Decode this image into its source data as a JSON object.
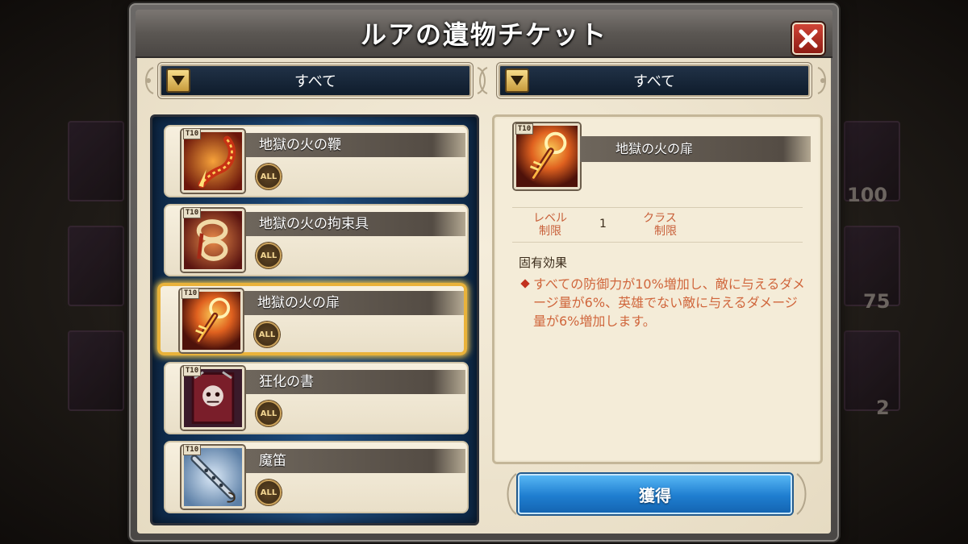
{
  "title": "ルアの遺物チケット",
  "filters": {
    "left_label": "すべて",
    "right_label": "すべて"
  },
  "background": {
    "numbers": [
      "100",
      "75",
      "2"
    ]
  },
  "items": [
    {
      "name": "地獄の火の鞭",
      "tier": "T10",
      "class_badge": "ALL",
      "icon": "flame-whip-icon"
    },
    {
      "name": "地獄の火の拘束具",
      "tier": "T10",
      "class_badge": "ALL",
      "icon": "flame-restraint-icon"
    },
    {
      "name": "地獄の火の扉",
      "tier": "T10",
      "class_badge": "ALL",
      "icon": "flame-key-icon",
      "selected": true
    },
    {
      "name": "狂化の書",
      "tier": "T10",
      "class_badge": "ALL",
      "icon": "berserk-book-icon"
    },
    {
      "name": "魔笛",
      "tier": "T10",
      "class_badge": "ALL",
      "icon": "magic-flute-icon"
    }
  ],
  "detail": {
    "name": "地獄の火の扉",
    "tier": "T10",
    "level_label_1": "レベル",
    "level_label_2": "制限",
    "level_value": "1",
    "class_label_1": "クラス",
    "class_label_2": "制限",
    "effect_title": "固有効果",
    "effect_text": "すべての防御力が10%増加し、敵に与えるダメージ量が6%、英雄でない敵に与えるダメージ量が6%増加します。"
  },
  "acquire_label": "獲得",
  "colors": {
    "accent_blue": "#1f7ed0",
    "selected_gold": "#e9b23a",
    "effect_text": "#d0663c",
    "close_red": "#c03a2c"
  }
}
